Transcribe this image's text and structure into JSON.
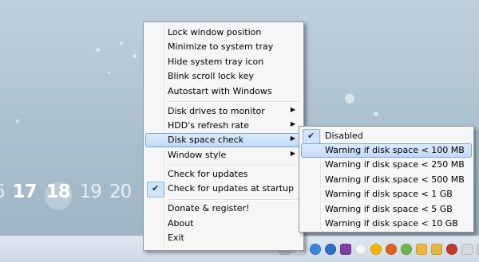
{
  "desktop": {
    "calendar_days": [
      "6",
      "17",
      "18",
      "19",
      "20"
    ]
  },
  "context_menu": {
    "items": [
      {
        "label": "Lock window position"
      },
      {
        "label": "Minimize to system tray"
      },
      {
        "label": "Hide system tray icon"
      },
      {
        "label": "Blink scroll lock key"
      },
      {
        "label": "Autostart with Windows"
      },
      {
        "label": "Disk drives to monitor",
        "submenu": true
      },
      {
        "label": "HDD's refresh rate",
        "submenu": true
      },
      {
        "label": "Disk space check",
        "submenu": true,
        "highlighted": true
      },
      {
        "label": "Window style",
        "submenu": true
      },
      {
        "label": "Check for updates"
      },
      {
        "label": "Check for updates at startup",
        "checked": true
      },
      {
        "label": "Donate & register!"
      },
      {
        "label": "About"
      },
      {
        "label": "Exit"
      }
    ]
  },
  "disk_space_submenu": {
    "items": [
      {
        "label": "Disabled",
        "checked": true
      },
      {
        "label": "Warning if disk space < 100 MB",
        "highlighted": true
      },
      {
        "label": "Warning if disk space < 250 MB"
      },
      {
        "label": "Warning if disk space < 500 MB"
      },
      {
        "label": "Warning if disk space < 1 GB"
      },
      {
        "label": "Warning if disk space < 5 GB"
      },
      {
        "label": "Warning if disk space < 10 GB"
      }
    ]
  },
  "icons": {
    "submenu_arrow": "▶",
    "checkmark": "✔"
  },
  "tray": {
    "icons": [
      "disk-icon",
      "drive-icon",
      "network-icon",
      "ie-icon",
      "onenote-icon",
      "chat-icon",
      "smiley-icon",
      "firefox-icon",
      "update-icon",
      "folder-icon",
      "folder2-icon",
      "antivirus-icon",
      "volume-icon",
      "flag-icon"
    ]
  },
  "colors": {
    "highlight": "#c1dbfc",
    "menu_bg": "#f5f6f7",
    "desktop": "#a9bfce"
  }
}
